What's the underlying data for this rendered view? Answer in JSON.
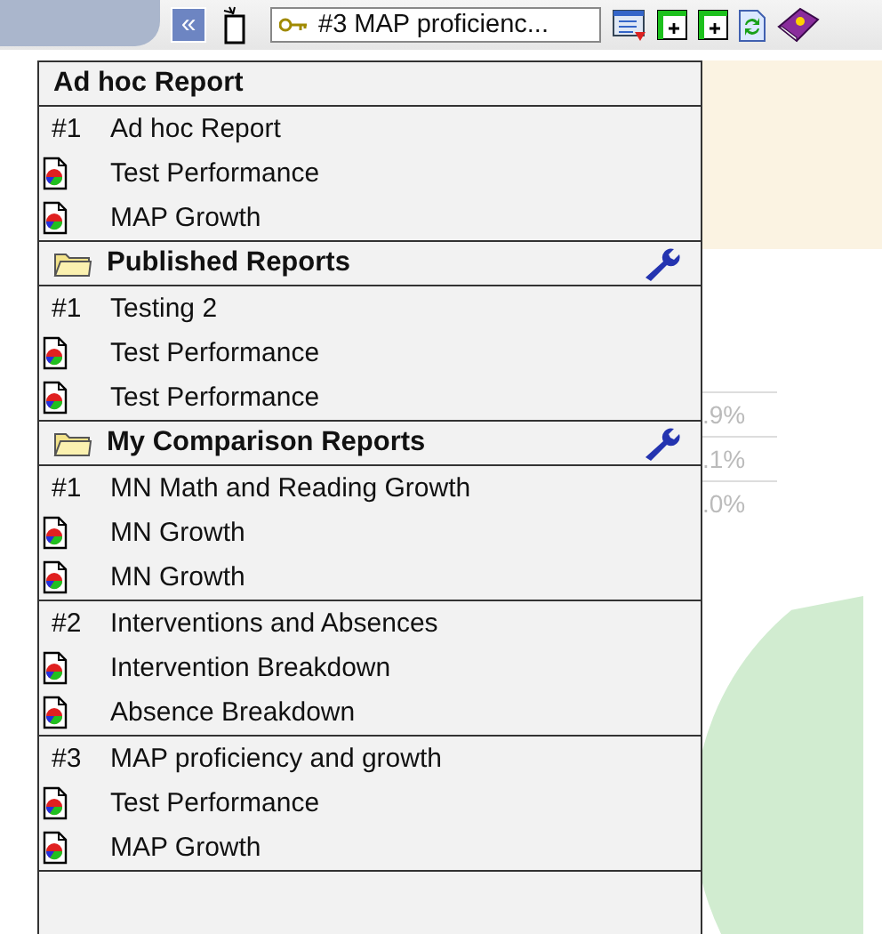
{
  "toolbar": {
    "collapse_button": "«",
    "report_picker": {
      "value": "#3 MAP proficienc..."
    }
  },
  "menu": {
    "sections": [
      {
        "kind": "plain",
        "title": "Ad hoc Report",
        "groups": [
          {
            "number": "#1",
            "title": "Ad hoc Report",
            "items": [
              "Test Performance",
              "MAP Growth"
            ]
          }
        ]
      },
      {
        "kind": "folder",
        "title": "Published Reports",
        "groups": [
          {
            "number": "#1",
            "title": "Testing 2",
            "items": [
              "Test Performance",
              "Test Performance"
            ]
          }
        ]
      },
      {
        "kind": "folder",
        "title": "My Comparison Reports",
        "groups": [
          {
            "number": "#1",
            "title": "MN Math and Reading Growth",
            "items": [
              "MN Growth",
              "MN Growth"
            ]
          },
          {
            "number": "#2",
            "title": "Interventions and Absences",
            "items": [
              "Intervention Breakdown",
              "Absence Breakdown"
            ]
          },
          {
            "number": "#3",
            "title": "MAP proficiency and growth",
            "items": [
              "Test Performance",
              "MAP Growth"
            ]
          }
        ]
      }
    ]
  },
  "background": {
    "percentages": [
      ".9%",
      ".1%",
      ".0%"
    ]
  }
}
